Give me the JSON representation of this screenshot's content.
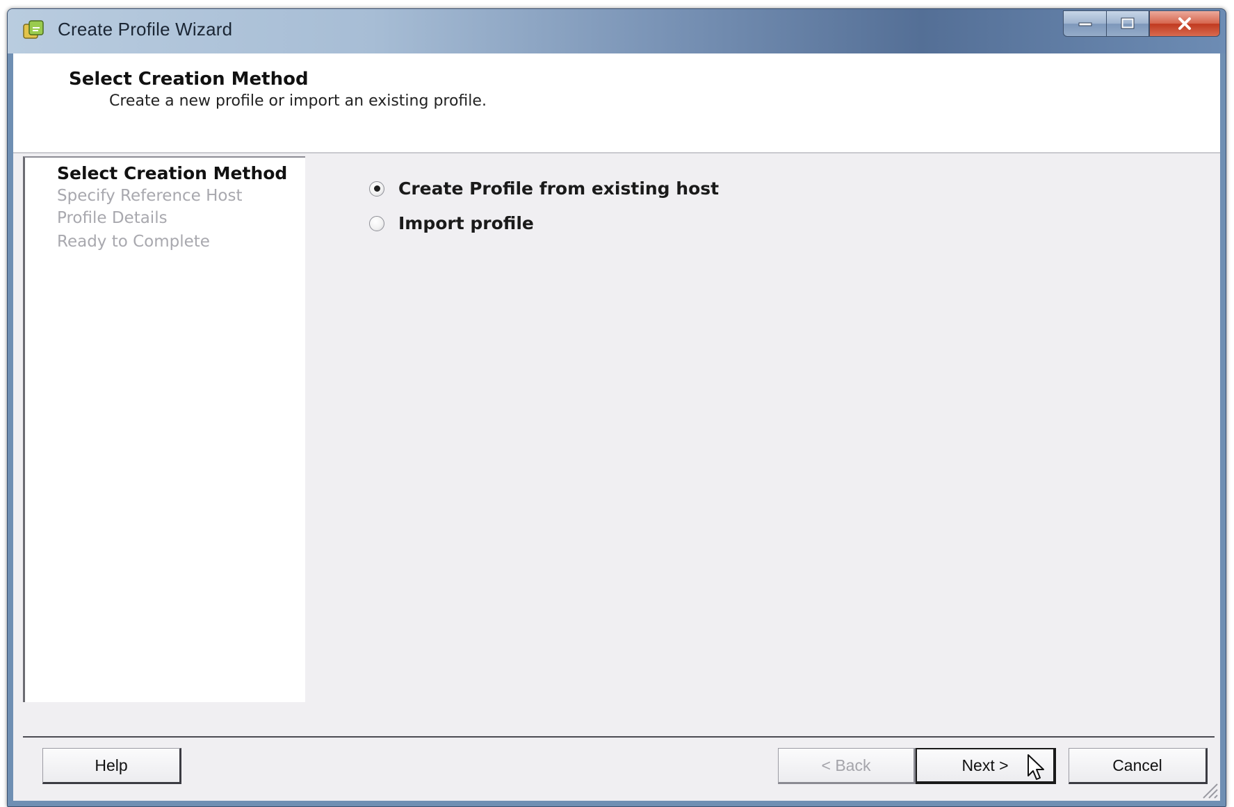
{
  "window": {
    "title": "Create Profile Wizard",
    "icon": "vsphere-profile-icon",
    "controls": [
      "minimize-icon",
      "maximize-icon",
      "close-icon"
    ]
  },
  "header": {
    "title": "Select Creation Method",
    "subtitle": "Create a new profile or import an existing profile."
  },
  "steps": [
    {
      "label": "Select Creation Method",
      "active": true
    },
    {
      "label": "Specify Reference Host",
      "active": false
    },
    {
      "label": "Profile Details",
      "active": false
    },
    {
      "label": "Ready to Complete",
      "active": false
    }
  ],
  "options": [
    {
      "label": "Create Profile from existing host",
      "selected": true
    },
    {
      "label": "Import profile",
      "selected": false
    }
  ],
  "buttons": {
    "help": "Help",
    "back": "< Back",
    "next": "Next >",
    "cancel": "Cancel"
  },
  "colors": {
    "titlebar_start": "#b9ccdf",
    "titlebar_end": "#546f96",
    "close_button": "#c0391f",
    "content_bg": "#f0eff2",
    "disabled_text": "#a8a8ae"
  }
}
